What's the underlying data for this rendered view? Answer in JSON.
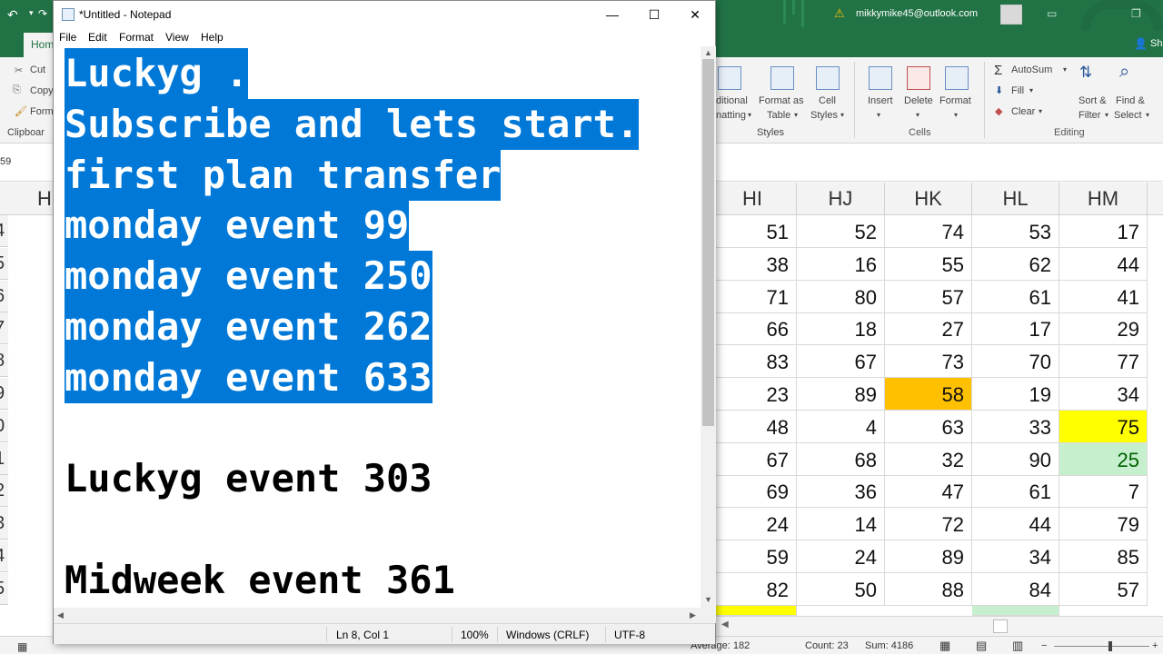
{
  "excel": {
    "account": "mikkymike45@outlook.com",
    "share_partial": "Sh",
    "tab_home_partial": "Hom",
    "clipboard": {
      "cut": "Cut",
      "copy_partial": "Copy",
      "format_partial": "Form",
      "group_partial": "Clipboar"
    },
    "styles": {
      "cond_line1": "ditional",
      "cond_line2": "natting",
      "format_as_table_l1": "Format as",
      "format_as_table_l2": "Table",
      "cell_styles_l1": "Cell",
      "cell_styles_l2": "Styles",
      "group": "Styles"
    },
    "cells_group": {
      "insert": "Insert",
      "delete": "Delete",
      "format": "Format",
      "group": "Cells"
    },
    "editing": {
      "autosum": "AutoSum",
      "fill": "Fill",
      "clear": "Clear",
      "sort_l1": "Sort &",
      "sort_l2": "Filter",
      "find_l1": "Find &",
      "find_l2": "Select",
      "group": "Editing"
    },
    "name_box_partial": "59",
    "left_col_partial": "H",
    "columns": [
      "HI",
      "HJ",
      "HK",
      "HL",
      "HM"
    ],
    "row_numbers_partial": [
      "4",
      "5",
      "6",
      "7",
      "8",
      "9",
      "0",
      "1",
      "2",
      "3",
      "4",
      "5"
    ],
    "rows": [
      [
        51,
        52,
        74,
        53,
        17
      ],
      [
        38,
        16,
        55,
        62,
        44
      ],
      [
        71,
        80,
        57,
        61,
        41
      ],
      [
        66,
        18,
        27,
        17,
        29
      ],
      [
        83,
        67,
        73,
        70,
        77
      ],
      [
        23,
        89,
        58,
        19,
        34
      ],
      [
        48,
        4,
        63,
        33,
        75
      ],
      [
        67,
        68,
        32,
        90,
        25
      ],
      [
        69,
        36,
        47,
        61,
        7
      ],
      [
        24,
        14,
        72,
        44,
        79
      ],
      [
        59,
        24,
        89,
        34,
        85
      ],
      [
        82,
        50,
        88,
        84,
        57
      ]
    ],
    "highlights": {
      "orange": "#ffc000",
      "yellow": "#ffff00",
      "light_green": "#c6efce",
      "green_text": "#006100"
    },
    "status": {
      "average": "Average: 182",
      "count": "Count: 23",
      "sum": "Sum: 4186"
    },
    "brand_color": "#217346"
  },
  "notepad": {
    "title": "*Untitled - Notepad",
    "menu": [
      "File",
      "Edit",
      "Format",
      "View",
      "Help"
    ],
    "controls": {
      "minimize": "—",
      "maximize": "☐",
      "close": "✕"
    },
    "lines": [
      {
        "text": "Luckyg .",
        "selected": true
      },
      {
        "text": "Subscribe and lets start.",
        "selected": true
      },
      {
        "text": "first plan transfer",
        "selected": true
      },
      {
        "text": "monday event 99",
        "selected": true
      },
      {
        "text": "monday event 250",
        "selected": true
      },
      {
        "text": "monday event 262",
        "selected": true
      },
      {
        "text": "monday event 633",
        "selected": true
      },
      {
        "text": "",
        "selected": false
      },
      {
        "text": "Luckyg event 303",
        "selected": false
      },
      {
        "text": "",
        "selected": false
      },
      {
        "text": "Midweek event 361",
        "selected": false
      }
    ],
    "status": {
      "position": "Ln 8, Col 1",
      "zoom": "100%",
      "line_endings": "Windows (CRLF)",
      "encoding": "UTF-8"
    },
    "selection_color": "#0078d7"
  }
}
